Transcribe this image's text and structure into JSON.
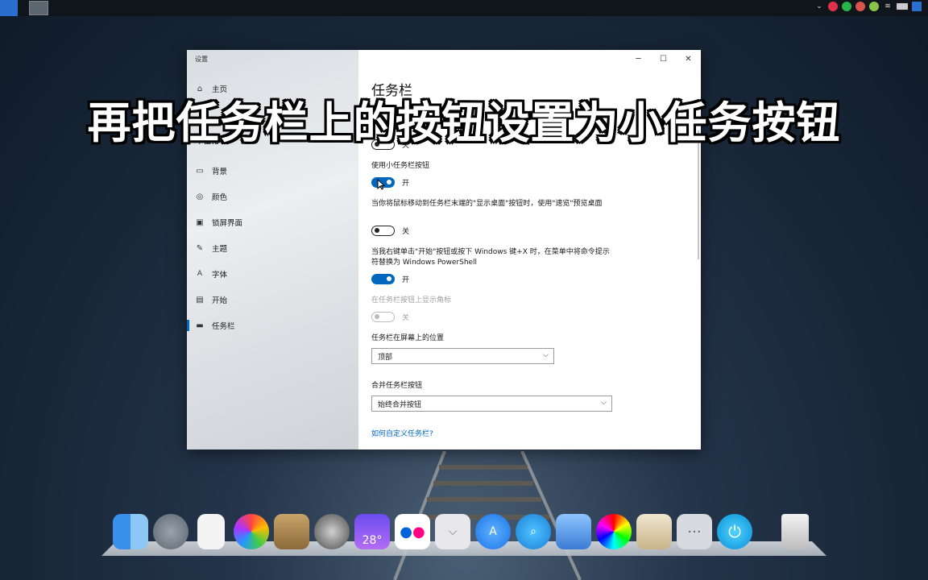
{
  "caption": "再把任务栏上的按钮设置为小任务按钮",
  "window": {
    "app_title": "设置",
    "controls": {
      "minimize": "─",
      "maximize": "☐",
      "close": "✕"
    }
  },
  "nav": {
    "home": "主页",
    "section": "个性化",
    "items": [
      {
        "label": "背景",
        "icon": "image-icon"
      },
      {
        "label": "颜色",
        "icon": "palette-icon"
      },
      {
        "label": "锁屏界面",
        "icon": "lock-screen-icon"
      },
      {
        "label": "主题",
        "icon": "brush-icon"
      },
      {
        "label": "字体",
        "icon": "font-icon"
      },
      {
        "label": "开始",
        "icon": "start-icon"
      },
      {
        "label": "任务栏",
        "icon": "taskbar-icon"
      }
    ],
    "active": "任务栏"
  },
  "content": {
    "title": "任务栏",
    "toggles": [
      {
        "label": "",
        "state_text": "关",
        "on": false
      },
      {
        "label": "使用小任务栏按钮",
        "state_text": "开",
        "on": true
      },
      {
        "label": "当你将鼠标移动到任务栏末端的\"显示桌面\"按钮时，使用\"速览\"预览桌面",
        "state_text": "关",
        "on": false
      },
      {
        "label": "当我右键单击\"开始\"按钮或按下 Windows 键+X 时，在菜单中将命令提示符替换为 Windows PowerShell",
        "state_text": "开",
        "on": true
      },
      {
        "label": "在任务栏按钮上显示角标",
        "state_text": "关",
        "on": false,
        "disabled": true
      }
    ],
    "position": {
      "label": "任务栏在屏幕上的位置",
      "value": "顶部"
    },
    "combine": {
      "label": "合并任务栏按钮",
      "value": "始终合并按钮"
    },
    "help_link": "如何自定义任务栏?"
  },
  "dock": {
    "weather_temp": "28°",
    "more_label": "···"
  }
}
